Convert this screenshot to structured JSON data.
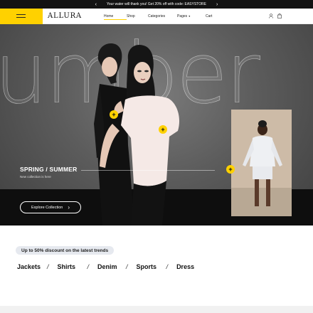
{
  "announcement": {
    "text": "Your water will thank you! Get 20% off with code: EASYSTORE",
    "prev_icon": "chevron-left-icon",
    "next_icon": "chevron-right-icon"
  },
  "header": {
    "logo": "ALLURA",
    "nav": [
      {
        "label": "Home",
        "active": true
      },
      {
        "label": "Shop"
      },
      {
        "label": "Categories"
      },
      {
        "label": "Pages",
        "has_dropdown": true
      },
      {
        "label": "Cart"
      }
    ],
    "icons": [
      "user-icon",
      "bag-icon"
    ],
    "accent": "#ffd100"
  },
  "hero": {
    "background_word": "umber",
    "season_title": "SPRING / SUMMER",
    "subtitle": "New collection is here",
    "cta": "Explore Collection",
    "hotspot_symbol": "+"
  },
  "promo": {
    "badge": "Up to 50% discount on the latest trends",
    "categories": [
      "Jackets",
      "Shirts",
      "Denim",
      "Sports",
      "Dress"
    ],
    "separator": "/"
  }
}
